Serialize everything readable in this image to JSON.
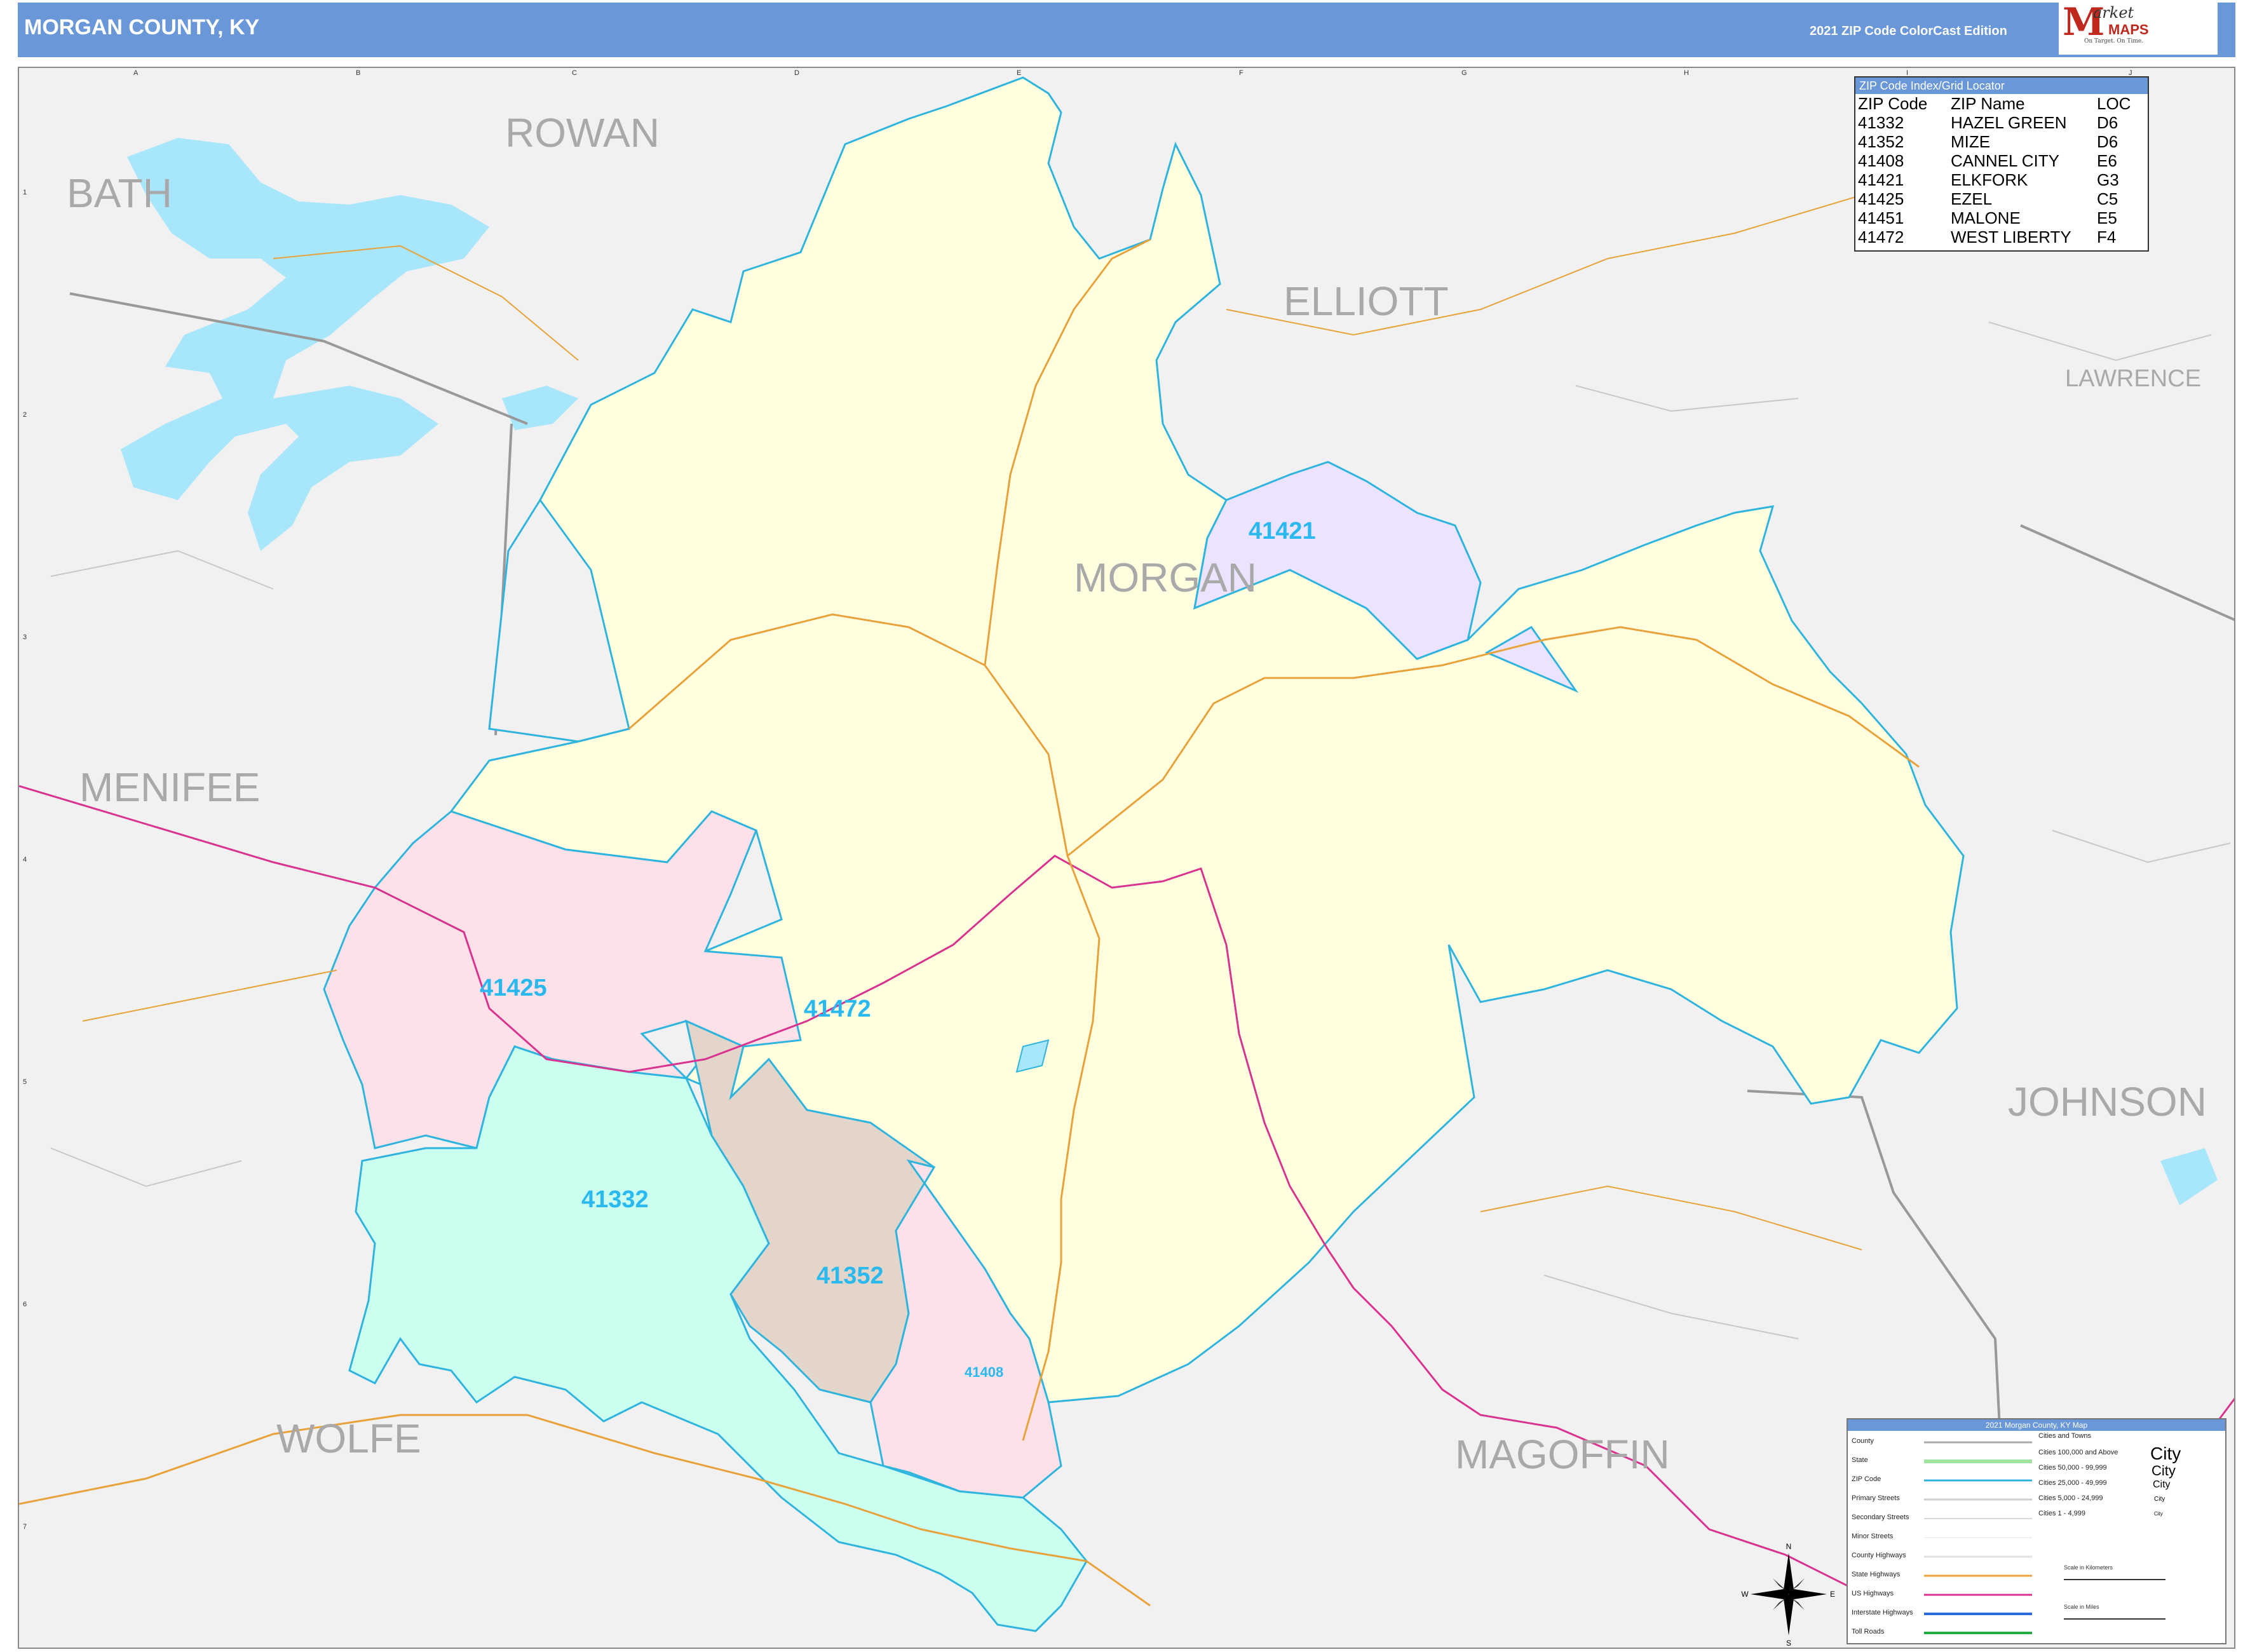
{
  "header": {
    "title": "MORGAN COUNTY, KY",
    "edition": "2021 ZIP Code ColorCast Edition",
    "logo_line1": "M",
    "logo_line2": "arket",
    "logo_line3": "MAPS",
    "logo_tagline": "On Target. On Time.",
    "brand_color": "#c0281e"
  },
  "map": {
    "grid_columns": [
      "A",
      "B",
      "C",
      "D",
      "E",
      "F",
      "G",
      "H",
      "I",
      "J"
    ],
    "grid_rows": [
      "1",
      "2",
      "3",
      "4",
      "5",
      "6",
      "7"
    ],
    "counties": [
      {
        "name": "ROWAN"
      },
      {
        "name": "BATH"
      },
      {
        "name": "ELLIOTT"
      },
      {
        "name": "LAWRENCE"
      },
      {
        "name": "MORGAN"
      },
      {
        "name": "MENIFEE"
      },
      {
        "name": "JOHNSON"
      },
      {
        "name": "WOLFE"
      },
      {
        "name": "MAGOFFIN"
      }
    ],
    "zip_areas": [
      {
        "zip": "41472",
        "color": "#ffffe0"
      },
      {
        "zip": "41421",
        "color": "#ebe3ff"
      },
      {
        "zip": "41425",
        "color": "#fce1e9"
      },
      {
        "zip": "41332",
        "color": "#cbfff0"
      },
      {
        "zip": "41352",
        "color": "#e3d5c9"
      },
      {
        "zip": "41408",
        "color": "#fce1e9"
      }
    ],
    "colors": {
      "background": "#f1f1f1",
      "water": "#a8e6fb",
      "zip_border": "#2fb4dd",
      "county_border": "#999999",
      "state_road": "#e8a23a",
      "us_highway": "#d9338f"
    }
  },
  "zip_index": {
    "title": "ZIP Code Index/Grid Locator",
    "headers": [
      "ZIP Code",
      "ZIP Name",
      "LOC"
    ],
    "rows": [
      [
        "41332",
        "HAZEL GREEN",
        "D6"
      ],
      [
        "41352",
        "MIZE",
        "D6"
      ],
      [
        "41408",
        "CANNEL CITY",
        "E6"
      ],
      [
        "41421",
        "ELKFORK",
        "G3"
      ],
      [
        "41425",
        "EZEL",
        "C5"
      ],
      [
        "41451",
        "MALONE",
        "E5"
      ],
      [
        "41472",
        "WEST LIBERTY",
        "F4"
      ]
    ]
  },
  "legend": {
    "title": "2021 Morgan County, KY Map",
    "items": [
      "County",
      "State",
      "ZIP Code",
      "Primary Streets",
      "Secondary Streets",
      "Minor Streets",
      "County Highways",
      "State Highways",
      "US Highways",
      "Interstate Highways",
      "Toll Roads"
    ],
    "city_header": "Cities and Towns",
    "city_sizes": [
      "Cities 100,000 and Above",
      "Cities 50,000 - 99,999",
      "Cities 25,000 - 49,999",
      "Cities 5,000 - 24,999",
      "Cities 1 - 4,999"
    ],
    "city_sample": "City",
    "scale_km": "Scale in Kilometers",
    "scale_mi": "Scale in Miles",
    "compass": [
      "N",
      "S",
      "E",
      "W"
    ]
  }
}
